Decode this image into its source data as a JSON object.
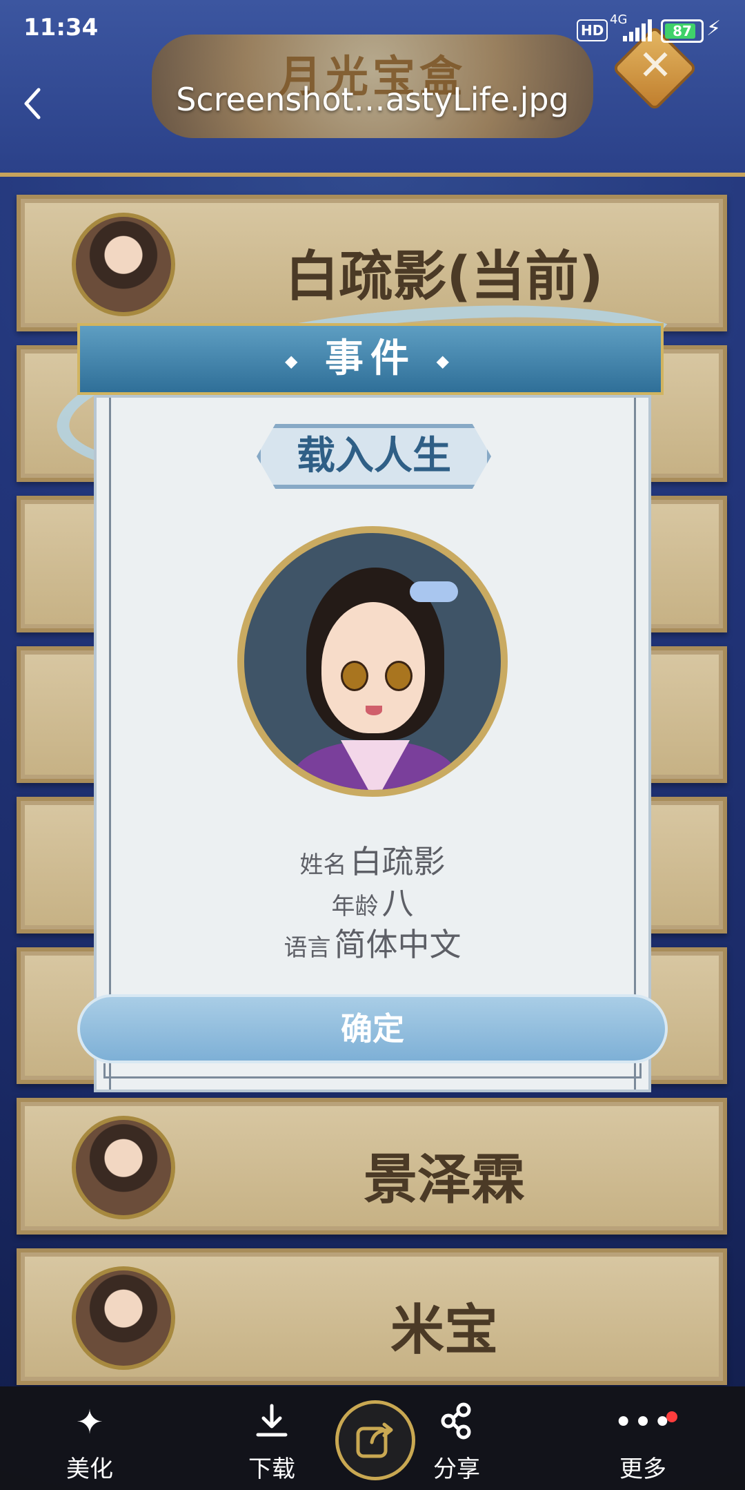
{
  "status": {
    "time": "11:34",
    "hd": "HD",
    "network": "4G",
    "battery": "87"
  },
  "viewer": {
    "title": "Screenshot…astyLife.jpg"
  },
  "game": {
    "title": "月光宝盒",
    "cards": [
      {
        "name": "白疏影(当前)"
      },
      {
        "name": "景泽霖"
      },
      {
        "name": "米宝"
      }
    ]
  },
  "modal": {
    "heading": "事件",
    "badge": "载入人生",
    "name_label": "姓名",
    "name_value": "白疏影",
    "age_label": "年龄",
    "age_value": "八",
    "lang_label": "语言",
    "lang_value": "简体中文",
    "confirm_label": "确定"
  },
  "toolbar": {
    "beautify": "美化",
    "download": "下载",
    "share": "分享",
    "more": "更多"
  },
  "colors": {
    "accent_blue": "#7eb0d6",
    "gold": "#c9aa61",
    "card_brown": "#4b3a26"
  }
}
